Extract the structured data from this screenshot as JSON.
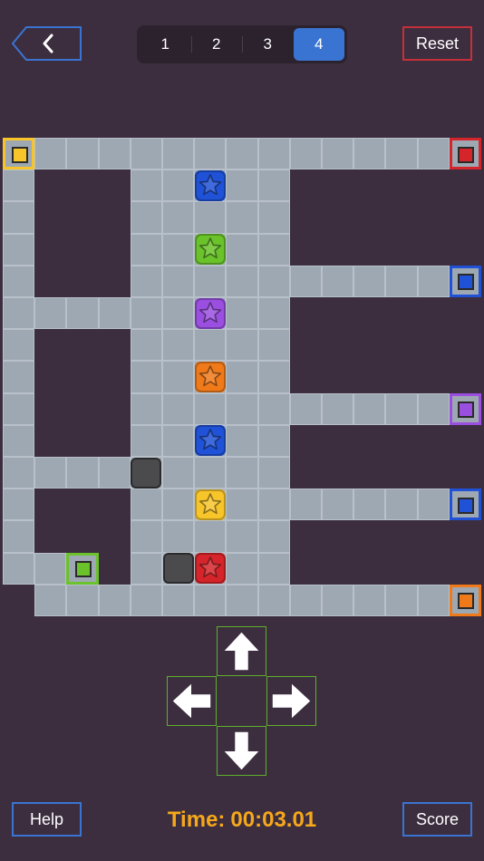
{
  "header": {
    "back_icon": "chevron-left-icon",
    "levels": [
      "1",
      "2",
      "3",
      "4"
    ],
    "active_level_index": 3,
    "reset_label": "Reset"
  },
  "board": {
    "tile_color": "#9ea8b3",
    "background_color": "#3c2e3f",
    "goals": [
      {
        "color": "#f7c52a",
        "name": "yellow"
      },
      {
        "color": "#d6252a",
        "name": "red"
      },
      {
        "color": "#1f52d6",
        "name": "blue"
      },
      {
        "color": "#9a4fe0",
        "name": "purple"
      },
      {
        "color": "#1f52d6",
        "name": "blue"
      },
      {
        "color": "#6ac32a",
        "name": "green"
      },
      {
        "color": "#f07a1a",
        "name": "orange"
      }
    ],
    "stars": [
      {
        "color": "#1f52d6",
        "name": "blue"
      },
      {
        "color": "#6ac32a",
        "name": "green"
      },
      {
        "color": "#9a4fe0",
        "name": "purple"
      },
      {
        "color": "#f07a1a",
        "name": "orange"
      },
      {
        "color": "#1f52d6",
        "name": "blue"
      },
      {
        "color": "#f7c52a",
        "name": "yellow"
      },
      {
        "color": "#d6252a",
        "name": "red"
      }
    ],
    "blocks": 2
  },
  "controls": {
    "up_icon": "arrow-up-icon",
    "left_icon": "arrow-left-icon",
    "right_icon": "arrow-right-icon",
    "down_icon": "arrow-down-icon"
  },
  "footer": {
    "help_label": "Help",
    "timer_label": "Time:",
    "timer_value": "00:03.01",
    "score_label": "Score"
  }
}
